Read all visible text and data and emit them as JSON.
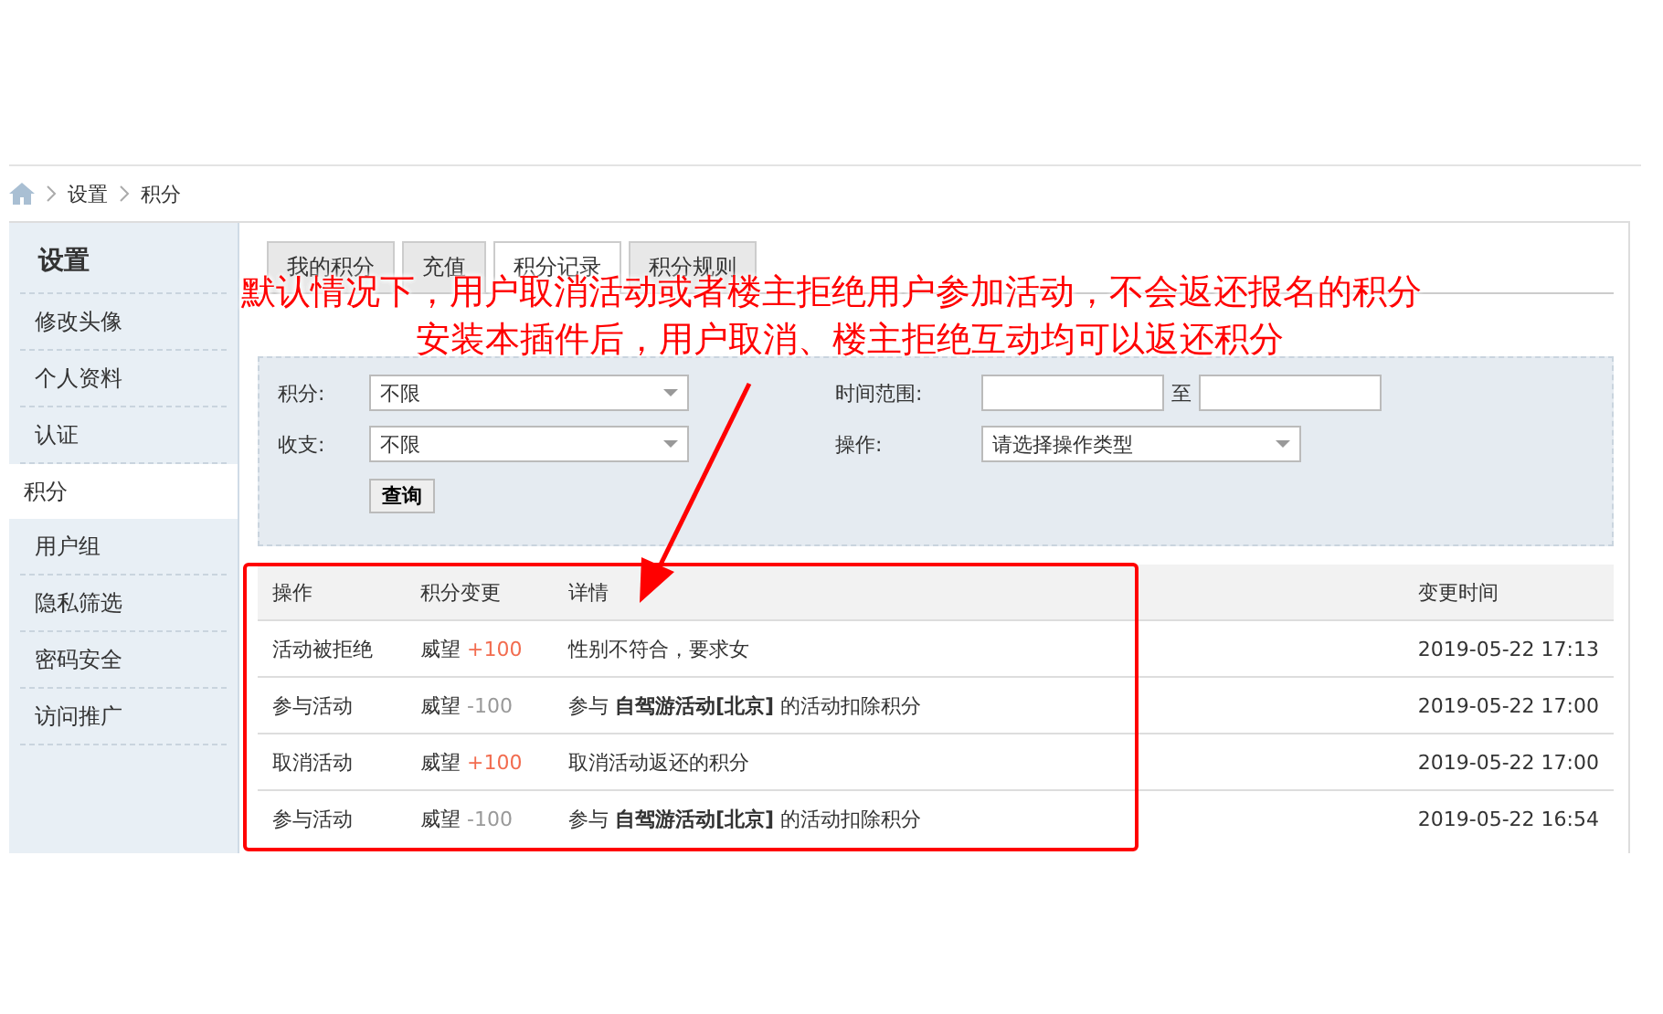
{
  "breadcrumb": [
    "设置",
    "积分"
  ],
  "sidebar": {
    "title": "设置",
    "items": [
      {
        "label": "修改头像",
        "selected": false
      },
      {
        "label": "个人资料",
        "selected": false
      },
      {
        "label": "认证",
        "selected": false
      },
      {
        "label": "积分",
        "selected": true
      },
      {
        "label": "用户组",
        "selected": false
      },
      {
        "label": "隐私筛选",
        "selected": false
      },
      {
        "label": "密码安全",
        "selected": false
      },
      {
        "label": "访问推广",
        "selected": false
      }
    ]
  },
  "tabs": [
    {
      "label": "我的积分",
      "selected": false
    },
    {
      "label": "充值",
      "selected": false
    },
    {
      "label": "积分记录",
      "selected": true
    },
    {
      "label": "积分规则",
      "selected": false
    }
  ],
  "filters": {
    "credit": {
      "label": "积分:",
      "value": "不限"
    },
    "flow": {
      "label": "收支:",
      "value": "不限"
    },
    "time": {
      "label": "时间范围:",
      "separator": "至"
    },
    "operation": {
      "label": "操作:",
      "value": "请选择操作类型"
    },
    "button": "查询"
  },
  "table": {
    "columns": [
      "操作",
      "积分变更",
      "详情",
      "变更时间"
    ],
    "rows": [
      {
        "action": "活动被拒绝",
        "credit": "威望",
        "change": "+100",
        "positive": true,
        "detail": "性别不符合，要求女",
        "time": "2019-05-22 17:13"
      },
      {
        "action": "参与活动",
        "credit": "威望",
        "change": "-100",
        "positive": false,
        "detail": "参与 **自驾游活动[北京]** 的活动扣除积分",
        "time": "2019-05-22 17:00"
      },
      {
        "action": "取消活动",
        "credit": "威望",
        "change": "+100",
        "positive": true,
        "detail": "取消活动返还的积分",
        "time": "2019-05-22 17:00"
      },
      {
        "action": "参与活动",
        "credit": "威望",
        "change": "-100",
        "positive": false,
        "detail": "参与 **自驾游活动[北京]** 的活动扣除积分",
        "time": "2019-05-22 16:54"
      }
    ]
  },
  "annotation": [
    "默认情况下，用户取消活动或者楼主拒绝用户参加活动，不会返还报名的积分",
    "安装本插件后，用户取消、楼主拒绝互动均可以返还积分"
  ]
}
